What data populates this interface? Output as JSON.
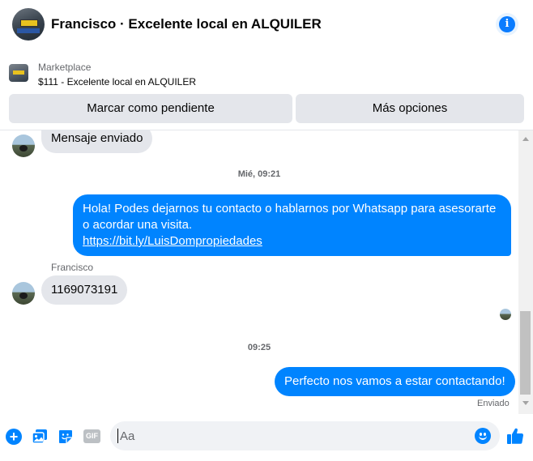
{
  "header": {
    "title": "Francisco · Excelente local en ALQUILER",
    "info_icon": "info-icon",
    "info_glyph": "i"
  },
  "marketplace": {
    "label": "Marketplace",
    "listing_title": "$111 - Excelente local en ALQUILER",
    "buttons": {
      "pending": "Marcar como pendiente",
      "more": "Más opciones"
    }
  },
  "conversation": {
    "messages": [
      {
        "direction": "in",
        "text": "Mensaje enviado"
      },
      {
        "type": "timestamp",
        "text": "Mié, 09:21"
      },
      {
        "direction": "out",
        "text": "Hola!  Podes dejarnos tu contacto o hablarnos por Whatsapp para asesorarte o acordar una visita.",
        "link": "https://bit.ly/LuisDompropiedades"
      },
      {
        "direction": "in",
        "sender": "Francisco",
        "text": "1169073191"
      },
      {
        "type": "timestamp",
        "text": "09:25"
      },
      {
        "direction": "out",
        "text": "Perfecto nos vamos a estar contactando!",
        "status": "Enviado"
      }
    ]
  },
  "composer": {
    "placeholder": "Aa",
    "gif_label": "GIF",
    "plus_glyph": "+",
    "icons": [
      "plus-icon",
      "photo-icon",
      "sticker-icon",
      "gif-icon",
      "emoji-icon",
      "like-icon"
    ]
  },
  "colors": {
    "accent": "#0084ff",
    "bubble_in": "#e4e6eb",
    "secondary_text": "#65676b"
  }
}
